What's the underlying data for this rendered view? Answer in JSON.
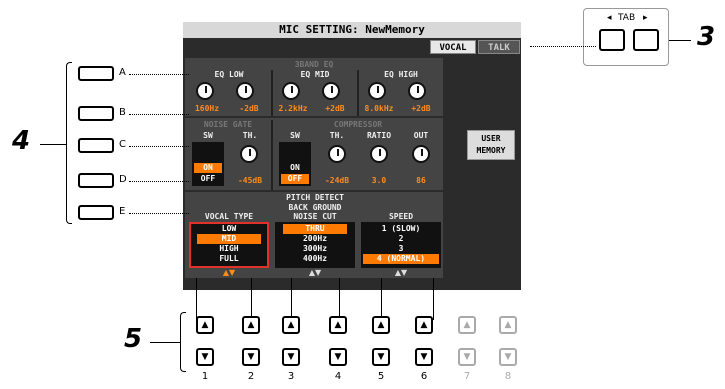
{
  "title": "MIC SETTING: NewMemory",
  "tabs": [
    "VOCAL",
    "TALK"
  ],
  "tab_label": "TAB",
  "tab_arrows": {
    "left": "◂",
    "right": "▸"
  },
  "callouts": {
    "n3": "3",
    "n4": "4",
    "n5": "5"
  },
  "side_buttons": [
    "A",
    "B",
    "C",
    "D",
    "E"
  ],
  "eq": {
    "title": "3BAND EQ",
    "bands": [
      {
        "label": "EQ LOW",
        "values": [
          "160Hz",
          "-2dB"
        ]
      },
      {
        "label": "EQ MID",
        "values": [
          "2.2kHz",
          "+2dB"
        ]
      },
      {
        "label": "EQ HIGH",
        "values": [
          "8.0kHz",
          "+2dB"
        ]
      }
    ]
  },
  "noise_gate": {
    "title": "NOISE GATE",
    "sw_label": "SW",
    "th_label": "TH.",
    "sw_options": [
      "ON",
      "OFF"
    ],
    "sw_selected": "ON",
    "th_value": "-45dB"
  },
  "compressor": {
    "title": "COMPRESSOR",
    "sw_label": "SW",
    "th_label": "TH.",
    "ratio_label": "RATIO",
    "out_label": "OUT",
    "sw_options": [
      "ON",
      "OFF"
    ],
    "sw_selected": "OFF",
    "th_value": "-24dB",
    "ratio_value": "3.0",
    "out_value": "86"
  },
  "user_memory": [
    "USER",
    "MEMORY"
  ],
  "pitch_detect": {
    "title": "PITCH DETECT",
    "vocal_type": {
      "label": "VOCAL TYPE",
      "options": [
        "LOW",
        "MID",
        "HIGH",
        "FULL"
      ],
      "selected": "MID"
    },
    "noise_cut": {
      "label1": "BACK GROUND",
      "label2": "NOISE CUT",
      "options": [
        "THRU",
        "200Hz",
        "300Hz",
        "400Hz"
      ],
      "selected": "THRU"
    },
    "speed": {
      "label": "SPEED",
      "options": [
        "1 (SLOW)",
        "2",
        "3",
        "4 (NORMAL)"
      ],
      "selected": "4 (NORMAL)"
    }
  },
  "arrows": "▲▼",
  "bottom_buttons": {
    "up": "▲",
    "down": "▼",
    "numbers": [
      "1",
      "2",
      "3",
      "4",
      "5",
      "6",
      "7",
      "8"
    ]
  }
}
